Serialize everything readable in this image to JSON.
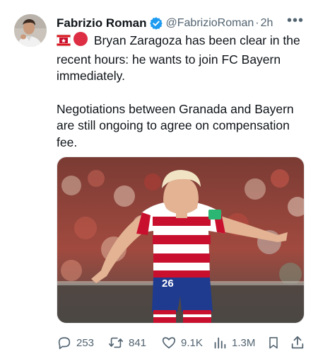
{
  "author": {
    "name": "Fabrizio Roman",
    "handle": "@FabrizioRoman",
    "separator": "·",
    "time": "2h",
    "more": "•••"
  },
  "tweet": {
    "line1": "Bryan Zaragoza has been clear in the recent hours: he wants to join FC Bayern immediately.",
    "line2": "Negotiations between Granada and Bayern are still ongoing to agree on compensation fee."
  },
  "colors": {
    "verified": "#1d9bf0",
    "text": "#0f1419",
    "muted": "#536471"
  },
  "actions": {
    "replies": "253",
    "reposts": "841",
    "likes": "9.1K",
    "views": "1.3M"
  },
  "media": {
    "shirt_number": "26"
  }
}
